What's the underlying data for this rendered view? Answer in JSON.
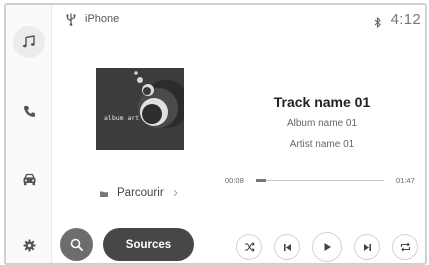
{
  "status": {
    "device_name": "iPhone",
    "clock": "4:12",
    "usb_icon": "usb-icon",
    "bluetooth_icon": "bluetooth-icon"
  },
  "sidebar": {
    "items": [
      {
        "icon": "music-note-icon",
        "active": true
      },
      {
        "icon": "phone-icon",
        "active": false
      },
      {
        "icon": "car-icon",
        "active": false
      },
      {
        "icon": "gear-icon",
        "active": false
      }
    ]
  },
  "album_art": {
    "text": "album art"
  },
  "track": {
    "title": "Track name 01",
    "album": "Album name 01",
    "artist": "Artist name 01"
  },
  "progress": {
    "elapsed": "00:08",
    "total": "01:47",
    "fraction": 0.075
  },
  "browse": {
    "label": "Parcourir"
  },
  "bottom": {
    "sources_label": "Sources"
  },
  "controls": [
    {
      "icon": "shuffle-icon"
    },
    {
      "icon": "previous-track-icon"
    },
    {
      "icon": "play-icon"
    },
    {
      "icon": "next-track-icon"
    },
    {
      "icon": "repeat-icon"
    }
  ],
  "colors": {
    "sources_button": "#474747",
    "search_button": "#6d6d6d",
    "album_art_bg": "#3c3c3c"
  }
}
